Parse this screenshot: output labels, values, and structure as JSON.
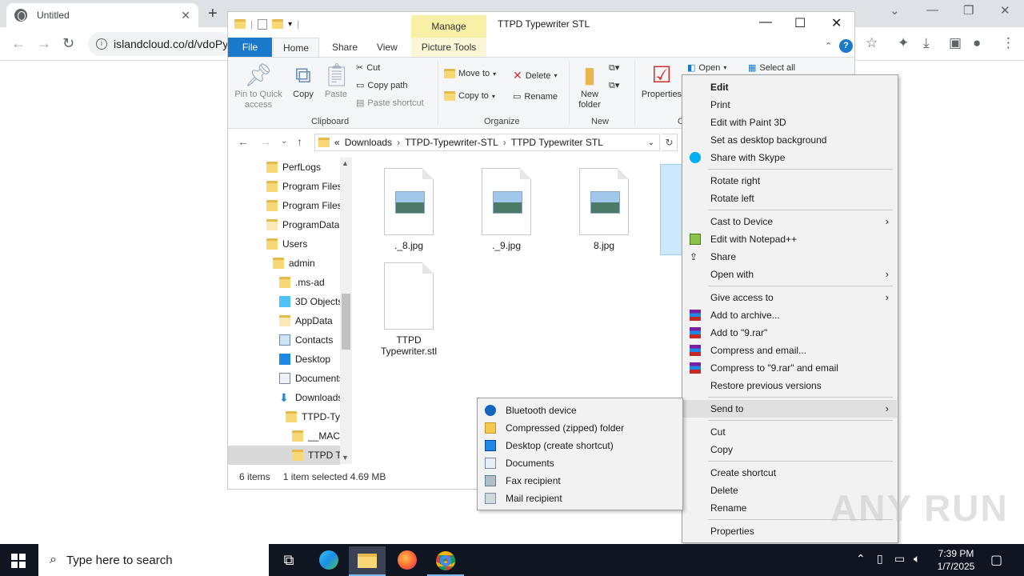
{
  "browser": {
    "tab_title": "Untitled",
    "url": "islandcloud.co/d/vdoPy"
  },
  "explorer": {
    "manage_label": "Manage",
    "window_title": "TTPD Typewriter STL",
    "tabs": {
      "file": "File",
      "home": "Home",
      "share": "Share",
      "view": "View",
      "picture_tools": "Picture Tools"
    },
    "ribbon": {
      "pin": "Pin to Quick access",
      "copy": "Copy",
      "paste": "Paste",
      "cut": "Cut",
      "copy_path": "Copy path",
      "paste_shortcut": "Paste shortcut",
      "clipboard": "Clipboard",
      "move_to": "Move to",
      "copy_to": "Copy to",
      "delete": "Delete",
      "rename": "Rename",
      "organize": "Organize",
      "new_folder": "New folder",
      "new": "New",
      "properties": "Properties",
      "open": "Open",
      "select_all": "Select all",
      "open_group": "O"
    },
    "address": {
      "prefix": "«",
      "crumbs": [
        "Downloads",
        "TTPD-Typewriter-STL",
        "TTPD Typewriter STL"
      ]
    },
    "tree": [
      "PerfLogs",
      "Program Files",
      "Program Files",
      "ProgramData",
      "Users",
      "admin",
      ".ms-ad",
      "3D Objects",
      "AppData",
      "Contacts",
      "Desktop",
      "Documents",
      "Downloads",
      "TTPD-Typ",
      "__MAC",
      "TTPD Ty"
    ],
    "files": [
      "._8.jpg",
      "._9.jpg",
      "8.jpg",
      "TTPD Typewriter.stl"
    ],
    "status": {
      "count": "6 items",
      "selected": "1 item selected  4.69 MB"
    }
  },
  "context_menu": {
    "edit": "Edit",
    "print": "Print",
    "paint3d": "Edit with Paint 3D",
    "desktop_bg": "Set as desktop background",
    "skype": "Share with Skype",
    "rotate_right": "Rotate right",
    "rotate_left": "Rotate left",
    "cast": "Cast to Device",
    "notepad": "Edit with Notepad++",
    "share": "Share",
    "open_with": "Open with",
    "give_access": "Give access to",
    "add_archive": "Add to archive...",
    "add_rar": "Add to \"9.rar\"",
    "compress_email": "Compress and email...",
    "compress_rar_email": "Compress to \"9.rar\" and email",
    "restore": "Restore previous versions",
    "send_to": "Send to",
    "cut": "Cut",
    "copy": "Copy",
    "create_shortcut": "Create shortcut",
    "delete": "Delete",
    "rename": "Rename",
    "properties": "Properties"
  },
  "send_to_menu": {
    "bluetooth": "Bluetooth device",
    "zip": "Compressed (zipped) folder",
    "desktop": "Desktop (create shortcut)",
    "documents": "Documents",
    "fax": "Fax recipient",
    "mail": "Mail recipient"
  },
  "taskbar": {
    "search_placeholder": "Type here to search",
    "time": "7:39 PM",
    "date": "1/7/2025"
  },
  "watermark": "ANY RUN"
}
